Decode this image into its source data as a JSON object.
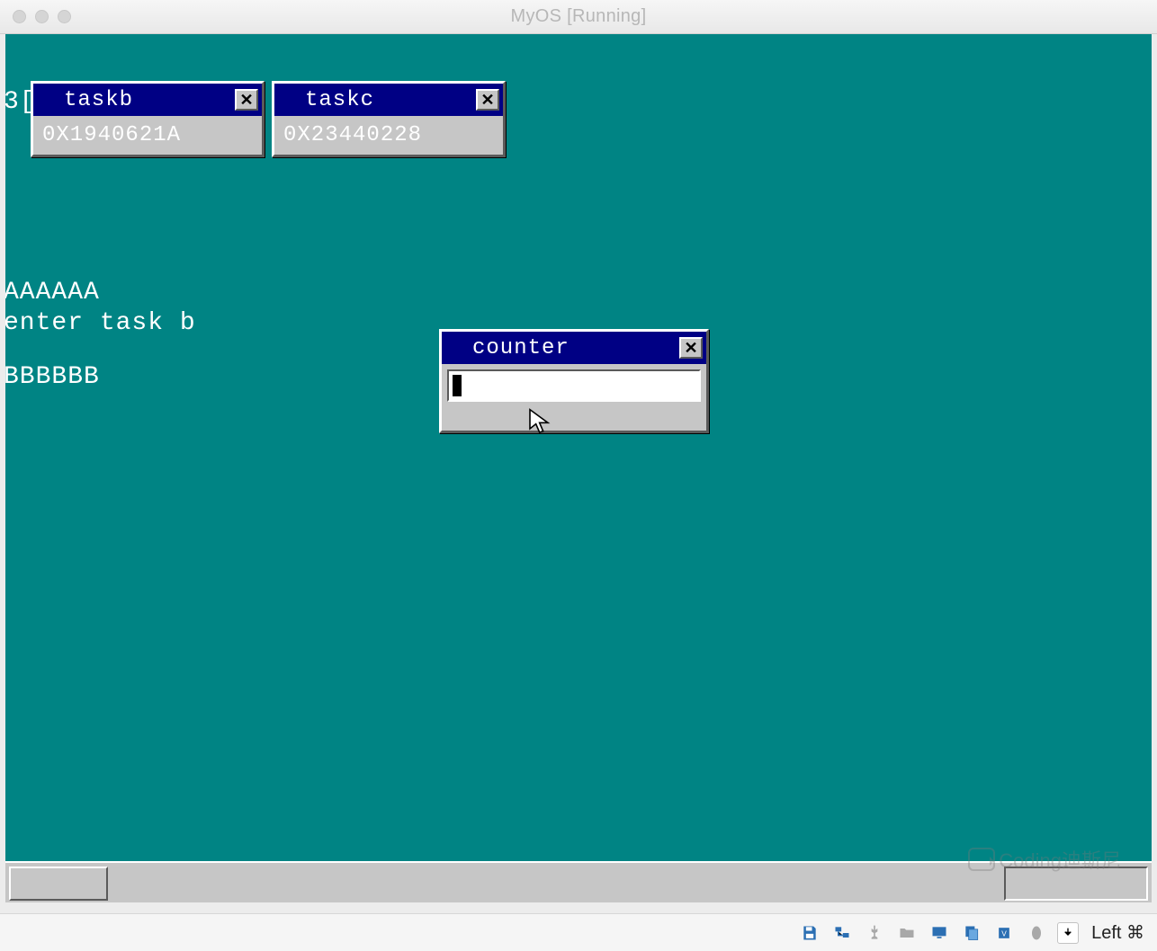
{
  "host": {
    "title": "MyOS [Running]",
    "capture_key": "Left ⌘"
  },
  "guest": {
    "bg_lines": {
      "line0": "3[",
      "line1": "AAAAAA",
      "line2": "enter task b",
      "line3": "BBBBBB"
    },
    "windows": {
      "taskb": {
        "title": "taskb",
        "value": "0X1940621A"
      },
      "taskc": {
        "title": "taskc",
        "value": "0X23440228"
      },
      "counter": {
        "title": "counter",
        "value": ""
      }
    }
  },
  "watermark": "Coding迪斯尼",
  "status_icons": [
    "floppy",
    "network",
    "usb",
    "folder",
    "display",
    "clipboard",
    "chip",
    "mouse"
  ]
}
